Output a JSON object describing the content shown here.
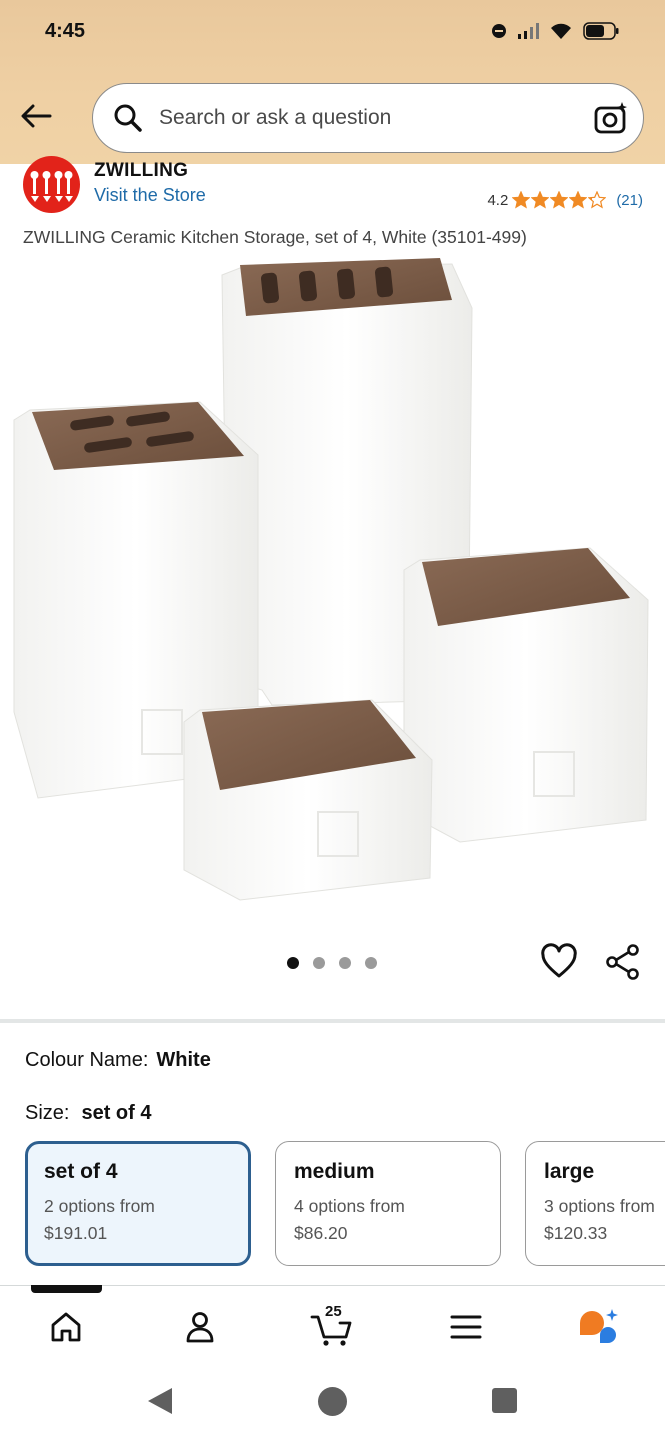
{
  "status_bar": {
    "time": "4:45"
  },
  "search": {
    "placeholder": "Search or ask a question"
  },
  "brand": {
    "name": "ZWILLING",
    "store_link": "Visit the Store"
  },
  "rating": {
    "value": "4.2",
    "stars": 4.2,
    "count": "(21)",
    "star_color": "#f08a24"
  },
  "product": {
    "title": "ZWILLING Ceramic Kitchen Storage, set of 4, White (35101-499)"
  },
  "carousel": {
    "total": 4,
    "active_index": 0
  },
  "options": {
    "colour_label": "Colour Name:",
    "colour_value": "White",
    "size_label": "Size:",
    "size_value": "set of 4",
    "sizes": [
      {
        "name": "set of 4",
        "options": "2 options from",
        "price": "$191.01",
        "selected": true
      },
      {
        "name": "medium",
        "options": "4 options from",
        "price": "$86.20",
        "selected": false
      },
      {
        "name": "large",
        "options": "3 options from",
        "price": "$120.33",
        "selected": false
      }
    ]
  },
  "bottom_nav": {
    "items": [
      "home-icon",
      "account-icon",
      "cart-icon",
      "menu-icon",
      "rufus-icon"
    ],
    "cart_count": "25"
  },
  "colors": {
    "accent_selected": "#2d5f8f",
    "link": "#1f6ba8",
    "header_bg": "#efd0a4"
  }
}
